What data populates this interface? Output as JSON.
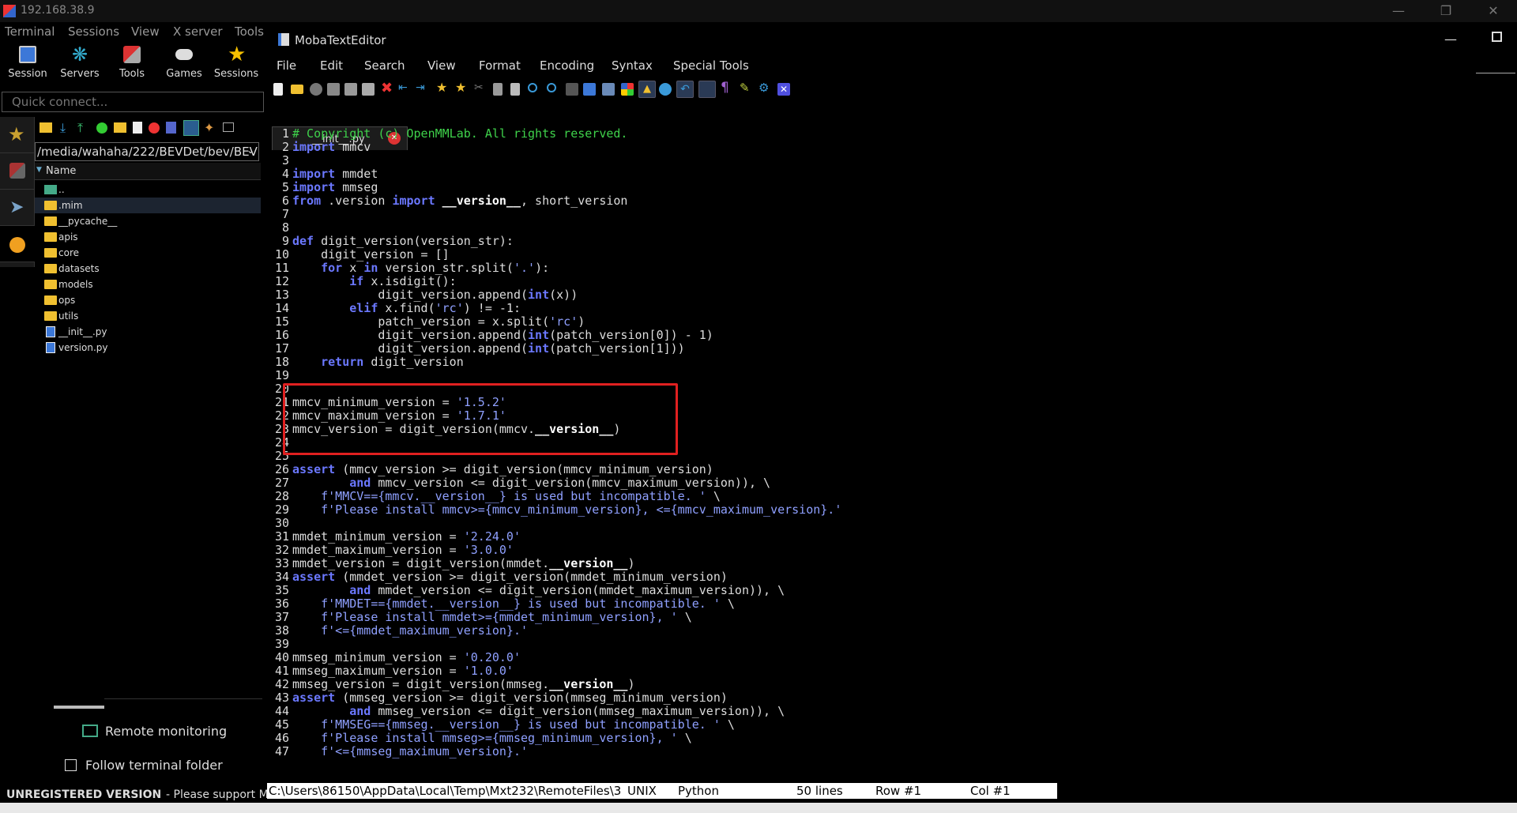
{
  "outer_window": {
    "title": "192.168.38.9"
  },
  "mobaxterm": {
    "menu": [
      "Terminal",
      "Sessions",
      "View",
      "X server",
      "Tools"
    ],
    "toolbar": [
      "Session",
      "Servers",
      "Tools",
      "Games",
      "Sessions"
    ],
    "quick_connect_placeholder": "Quick connect...",
    "path": "/media/wahaha/222/BEVDet/bev/BEV",
    "file_header": "Name",
    "files": [
      {
        "name": "..",
        "type": "parent"
      },
      {
        "name": ".mim",
        "type": "folder"
      },
      {
        "name": "__pycache__",
        "type": "folder"
      },
      {
        "name": "apis",
        "type": "folder"
      },
      {
        "name": "core",
        "type": "folder"
      },
      {
        "name": "datasets",
        "type": "folder"
      },
      {
        "name": "models",
        "type": "folder"
      },
      {
        "name": "ops",
        "type": "folder"
      },
      {
        "name": "utils",
        "type": "folder"
      },
      {
        "name": "__init__.py",
        "type": "python"
      },
      {
        "name": "version.py",
        "type": "python"
      }
    ],
    "remote_monitoring": "Remote monitoring",
    "follow_terminal_folder": "Follow terminal folder",
    "unregistered": "UNREGISTERED VERSION",
    "support_text": "- Please support M"
  },
  "editor": {
    "title": "MobaTextEditor",
    "menu": [
      "File",
      "Edit",
      "Search",
      "View",
      "Format",
      "Encoding",
      "Syntax",
      "Special Tools"
    ],
    "tab_label": "__init__.py",
    "status": {
      "path": "C:\\Users\\86150\\AppData\\Local\\Temp\\Mxt232\\RemoteFiles\\3",
      "eol": "UNIX",
      "syntax": "Python",
      "lines": "50 lines",
      "row": "Row #1",
      "col": "Col #1"
    },
    "code_lines": [
      "# Copyright (c) OpenMMLab. All rights reserved.",
      "import mmcv",
      "",
      "import mmdet",
      "import mmseg",
      "from .version import __version__, short_version",
      "",
      "",
      "def digit_version(version_str):",
      "    digit_version = []",
      "    for x in version_str.split('.'):",
      "        if x.isdigit():",
      "            digit_version.append(int(x))",
      "        elif x.find('rc') != -1:",
      "            patch_version = x.split('rc')",
      "            digit_version.append(int(patch_version[0]) - 1)",
      "            digit_version.append(int(patch_version[1]))",
      "    return digit_version",
      "",
      "",
      "mmcv_minimum_version = '1.5.2'",
      "mmcv_maximum_version = '1.7.1'",
      "mmcv_version = digit_version(mmcv.__version__)",
      "",
      "",
      "assert (mmcv_version >= digit_version(mmcv_minimum_version)",
      "        and mmcv_version <= digit_version(mmcv_maximum_version)), \\",
      "    f'MMCV=={mmcv.__version__} is used but incompatible. ' \\",
      "    f'Please install mmcv>={mmcv_minimum_version}, <={mmcv_maximum_version}.'",
      "",
      "mmdet_minimum_version = '2.24.0'",
      "mmdet_maximum_version = '3.0.0'",
      "mmdet_version = digit_version(mmdet.__version__)",
      "assert (mmdet_version >= digit_version(mmdet_minimum_version)",
      "        and mmdet_version <= digit_version(mmdet_maximum_version)), \\",
      "    f'MMDET=={mmdet.__version__} is used but incompatible. ' \\",
      "    f'Please install mmdet>={mmdet_minimum_version}, ' \\",
      "    f'<={mmdet_maximum_version}.'",
      "",
      "mmseg_minimum_version = '0.20.0'",
      "mmseg_maximum_version = '1.0.0'",
      "mmseg_version = digit_version(mmseg.__version__)",
      "assert (mmseg_version >= digit_version(mmseg_minimum_version)",
      "        and mmseg_version <= digit_version(mmseg_maximum_version)), \\",
      "    f'MMSEG=={mmseg.__version__} is used but incompatible. ' \\",
      "    f'Please install mmseg>={mmseg_minimum_version}, ' \\",
      "    f'<={mmseg_maximum_version}.'"
    ]
  }
}
